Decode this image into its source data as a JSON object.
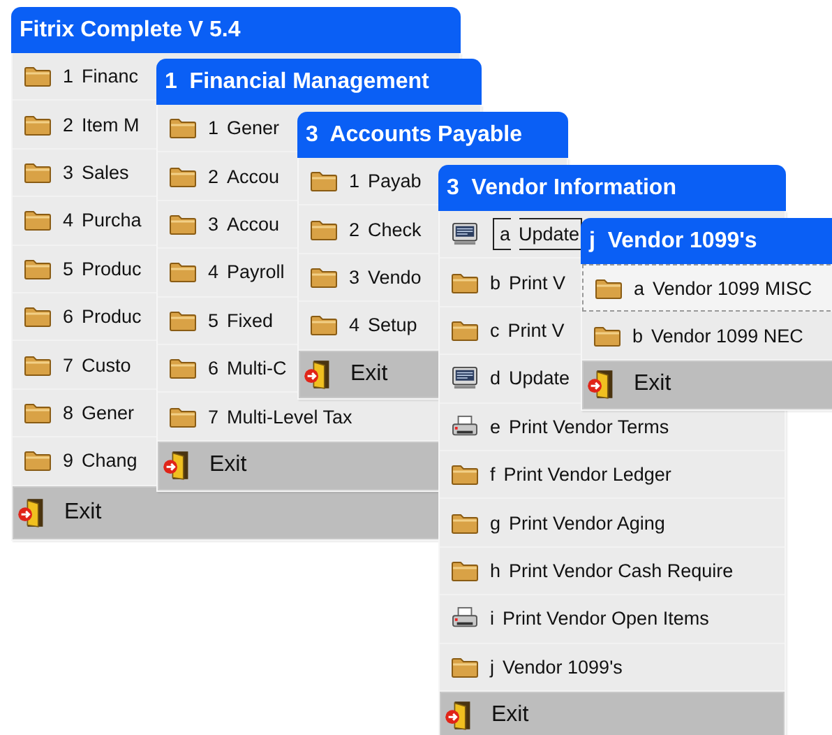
{
  "menus": [
    {
      "title": "Fitrix Complete V 5.4",
      "items": [
        {
          "key": "1",
          "label": "Financ",
          "kind": "folder",
          "focused": false
        },
        {
          "key": "2",
          "label": "Item M",
          "kind": "folder",
          "focused": false
        },
        {
          "key": "3",
          "label": "Sales",
          "kind": "folder",
          "focused": false
        },
        {
          "key": "4",
          "label": "Purcha",
          "kind": "folder",
          "focused": false
        },
        {
          "key": "5",
          "label": "Produc",
          "kind": "folder",
          "focused": false
        },
        {
          "key": "6",
          "label": "Produc",
          "kind": "folder",
          "focused": false
        },
        {
          "key": "7",
          "label": "Custo",
          "kind": "folder",
          "focused": false
        },
        {
          "key": "8",
          "label": "Gener",
          "kind": "folder",
          "focused": false
        },
        {
          "key": "9",
          "label": "Chang",
          "kind": "folder",
          "focused": false
        },
        {
          "label": "Exit",
          "kind": "exit",
          "focused": false
        }
      ]
    },
    {
      "title": "1  Financial Management",
      "items": [
        {
          "key": "1",
          "label": "Gener",
          "kind": "folder",
          "focused": false
        },
        {
          "key": "2",
          "label": "Accou",
          "kind": "folder",
          "focused": false
        },
        {
          "key": "3",
          "label": "Accou",
          "kind": "folder",
          "focused": false
        },
        {
          "key": "4",
          "label": "Payroll",
          "kind": "folder",
          "focused": false
        },
        {
          "key": "5",
          "label": "Fixed",
          "kind": "folder",
          "focused": false
        },
        {
          "key": "6",
          "label": "Multi-C",
          "kind": "folder",
          "focused": false
        },
        {
          "key": "7",
          "label": "Multi-Level Tax",
          "kind": "folder",
          "focused": false
        },
        {
          "label": "Exit",
          "kind": "exit",
          "focused": false
        }
      ]
    },
    {
      "title": "3  Accounts Payable",
      "items": [
        {
          "key": "1",
          "label": "Payab",
          "kind": "folder",
          "focused": false
        },
        {
          "key": "2",
          "label": "Check",
          "kind": "folder",
          "focused": false
        },
        {
          "key": "3",
          "label": "Vendo",
          "kind": "folder",
          "focused": false
        },
        {
          "key": "4",
          "label": "Setup",
          "kind": "folder",
          "focused": false
        },
        {
          "label": "Exit",
          "kind": "exit",
          "focused": false
        }
      ]
    },
    {
      "title": "3  Vendor Information",
      "items": [
        {
          "key": "a",
          "label": "Update",
          "kind": "program",
          "focused": true
        },
        {
          "key": "b",
          "label": "Print V",
          "kind": "folder",
          "focused": false
        },
        {
          "key": "c",
          "label": "Print V",
          "kind": "folder",
          "focused": false
        },
        {
          "key": "d",
          "label": "Update",
          "kind": "program",
          "focused": false
        },
        {
          "key": "e",
          "label": "Print Vendor Terms",
          "kind": "printer",
          "focused": false
        },
        {
          "key": "f",
          "label": "Print Vendor Ledger",
          "kind": "folder",
          "focused": false
        },
        {
          "key": "g",
          "label": "Print Vendor Aging",
          "kind": "folder",
          "focused": false
        },
        {
          "key": "h",
          "label": "Print Vendor Cash Require",
          "kind": "folder",
          "focused": false
        },
        {
          "key": "i",
          "label": "Print Vendor Open Items",
          "kind": "printer",
          "focused": false
        },
        {
          "key": "j",
          "label": "Vendor 1099's",
          "kind": "folder",
          "focused": false
        },
        {
          "label": "Exit",
          "kind": "exit",
          "focused": false
        }
      ]
    },
    {
      "title": "j  Vendor 1099's",
      "items": [
        {
          "key": "a",
          "label": "Vendor 1099 MISC",
          "kind": "folder",
          "focused": true
        },
        {
          "key": "b",
          "label": "Vendor 1099 NEC",
          "kind": "folder",
          "focused": false
        },
        {
          "label": "Exit",
          "kind": "exit",
          "focused": false
        }
      ]
    }
  ]
}
